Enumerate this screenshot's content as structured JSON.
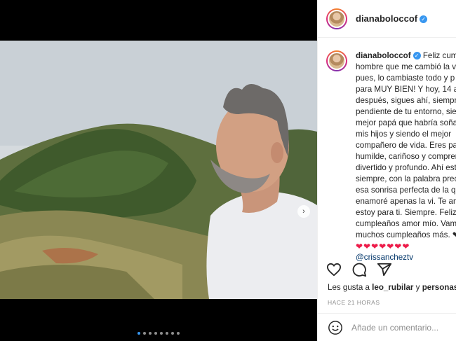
{
  "post": {
    "username": "dianaboloccof",
    "verified_mark": "✓",
    "caption_lines": [
      "Feliz cump",
      "hombre que me cambió la v",
      "pues, lo cambiaste todo y p",
      "para MUY BIEN! Y hoy, 14 a",
      "después, sigues ahí, siempre",
      "pendiente de tu entorno, sie",
      "mejor papá que habría soña",
      "mis hijos y siendo el mejor",
      "compañero de vida. Eres pac",
      "humilde, cariñoso y compren",
      "divertido y profundo. Ahí est",
      "siempre, con la palabra prec",
      "esa sonrisa perfecta de la qu",
      "enamoré apenas la vi. Te am",
      "estoy para ti. Siempre. Feliz",
      "cumpleaños amor mío. Vamo",
      "muchos cumpleaños más. ❤"
    ],
    "hearts": "❤❤❤❤❤❤❤",
    "mention": "@crissancheztv",
    "likes_prefix": "Les gusta a ",
    "likes_user": "leo_rubilar",
    "likes_suffix": " y ",
    "likes_others": "personas m",
    "time": "HACE 21 HORAS",
    "comment_placeholder": "Añade un comentario..."
  },
  "media": {
    "next_arrow": "›",
    "carousel_count": 8,
    "carousel_active": 1
  },
  "icons": {
    "like": "heart-outline-icon",
    "comment": "comment-bubble-icon",
    "share": "paper-plane-icon",
    "emoji": "emoji-icon"
  },
  "colors": {
    "accent": "#3897f0",
    "heart": "#ed1c4a",
    "text": "#262626",
    "muted": "#8e8e8e"
  }
}
